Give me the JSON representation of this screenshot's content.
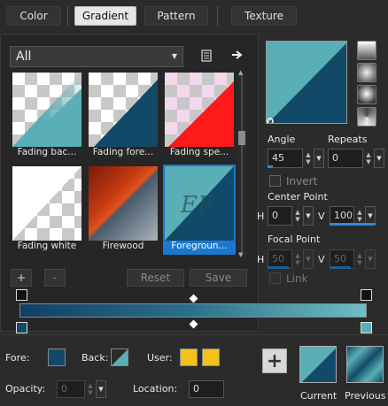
{
  "tabs": [
    {
      "label": "Color"
    },
    {
      "label": "Gradient"
    },
    {
      "label": "Pattern"
    },
    {
      "label": "Texture"
    }
  ],
  "category_select": {
    "value": "All"
  },
  "gradients": [
    {
      "label": "Fading bac..."
    },
    {
      "label": "Fading fore..."
    },
    {
      "label": "Fading spe..."
    },
    {
      "label": "Fading white"
    },
    {
      "label": "Firewood"
    },
    {
      "label": "Foregroun..."
    }
  ],
  "stop_buttons": {
    "add": "+",
    "remove": "-",
    "reset": "Reset",
    "save": "Save"
  },
  "angle": {
    "label": "Angle",
    "value": "45"
  },
  "repeats": {
    "label": "Repeats",
    "value": "0"
  },
  "invert": {
    "label": "Invert"
  },
  "center_point": {
    "label": "Center Point",
    "h_label": "H",
    "h_value": "0",
    "v_label": "V",
    "v_value": "100"
  },
  "focal_point": {
    "label": "Focal Point",
    "h_label": "H",
    "h_value": "50",
    "v_label": "V",
    "v_value": "50"
  },
  "link": {
    "label": "Link"
  },
  "bottom": {
    "fore_label": "Fore:",
    "back_label": "Back:",
    "user_label": "User:",
    "opacity_label": "Opacity:",
    "opacity_value": "0",
    "location_label": "Location:",
    "location_value": "0",
    "current_label": "Current",
    "previous_label": "Previous"
  },
  "colors": {
    "teal_light": "#5aaeb5",
    "teal_dark": "#114a68",
    "user_yellow": "#f2c21b",
    "selection_blue": "#1a78d0",
    "red": "#ff1a1a"
  }
}
